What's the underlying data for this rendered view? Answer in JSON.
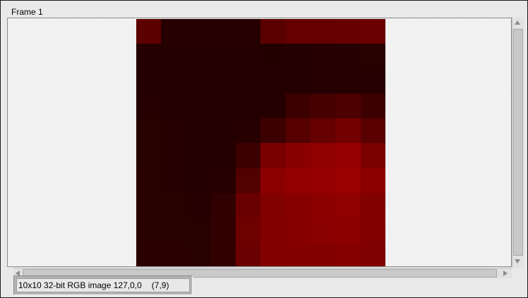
{
  "frame": {
    "title": "Frame 1"
  },
  "image": {
    "rows": [
      [
        "#5c0000",
        "#260000",
        "#260000",
        "#260000",
        "#260000",
        "#5a0000",
        "#640000",
        "#650000",
        "#670000",
        "#6a0000"
      ],
      [
        "#250000",
        "#240000",
        "#240000",
        "#240000",
        "#240000",
        "#230000",
        "#250000",
        "#260000",
        "#260000",
        "#270000"
      ],
      [
        "#250000",
        "#240000",
        "#240000",
        "#240000",
        "#240000",
        "#240000",
        "#240000",
        "#260000",
        "#260000",
        "#260000"
      ],
      [
        "#260000",
        "#250000",
        "#250000",
        "#250000",
        "#250000",
        "#250000",
        "#3d0000",
        "#460000",
        "#4c0000",
        "#3d0000"
      ],
      [
        "#270000",
        "#260000",
        "#250000",
        "#250000",
        "#260000",
        "#3c0000",
        "#560000",
        "#650000",
        "#720000",
        "#5a0000"
      ],
      [
        "#270000",
        "#260000",
        "#250000",
        "#250000",
        "#3b0000",
        "#7a0000",
        "#8a0000",
        "#900000",
        "#960000",
        "#7c0000"
      ],
      [
        "#280000",
        "#260000",
        "#250000",
        "#260000",
        "#520000",
        "#8c0000",
        "#920000",
        "#960000",
        "#9a0000",
        "#8d0000"
      ],
      [
        "#280000",
        "#270000",
        "#260000",
        "#310000",
        "#690000",
        "#810000",
        "#860000",
        "#8d0000",
        "#8f0000",
        "#810000"
      ],
      [
        "#290000",
        "#280000",
        "#270000",
        "#320000",
        "#6f0000",
        "#820000",
        "#860000",
        "#8b0000",
        "#8c0000",
        "#820000"
      ],
      [
        "#2b0000",
        "#2a0000",
        "#290000",
        "#330000",
        "#6a0000",
        "#820000",
        "#830000",
        "#830000",
        "#840000",
        "#7f0000"
      ]
    ]
  },
  "status": {
    "image_info": "10x10 32-bit RGB image 127,0,0",
    "coordinates": "(7,9)"
  }
}
